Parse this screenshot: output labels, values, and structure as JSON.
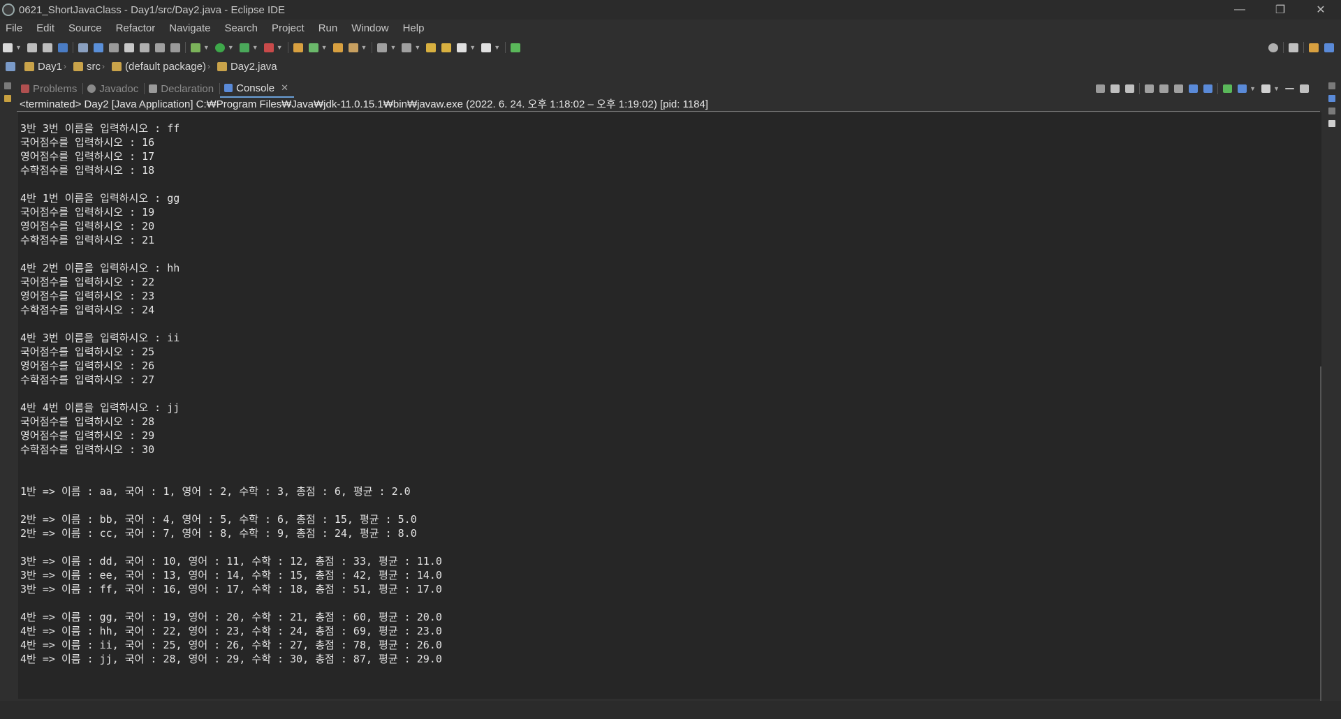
{
  "window": {
    "title": "0621_ShortJavaClass - Day1/src/Day2.java - Eclipse IDE",
    "minimize": "—",
    "restore": "❐",
    "close": "✕"
  },
  "menu": [
    "File",
    "Edit",
    "Source",
    "Refactor",
    "Navigate",
    "Search",
    "Project",
    "Run",
    "Window",
    "Help"
  ],
  "breadcrumb": [
    "Day1",
    "src",
    "(default package)",
    "Day2.java"
  ],
  "tabs": [
    {
      "label": "Problems",
      "icon": "problems-icon",
      "color": "#c05050"
    },
    {
      "label": "Javadoc",
      "icon": "javadoc-icon",
      "color": "#8a8a8a"
    },
    {
      "label": "Declaration",
      "icon": "declaration-icon",
      "color": "#9a9a9a"
    },
    {
      "label": "Console",
      "icon": "console-icon",
      "color": "#5a8ad8"
    }
  ],
  "console": {
    "status": "<terminated> Day2 [Java Application] C:₩Program Files₩Java₩jdk-11.0.15.1₩bin₩javaw.exe  (2022. 6. 24. 오후 1:18:02 – 오후 1:19:02) [pid: 1184]",
    "lines": [
      "3반 3번 이름을 입력하시오 : ff",
      "국어점수를 입력하시오 : 16",
      "영어점수를 입력하시오 : 17",
      "수학점수를 입력하시오 : 18",
      "",
      "4반 1번 이름을 입력하시오 : gg",
      "국어점수를 입력하시오 : 19",
      "영어점수를 입력하시오 : 20",
      "수학점수를 입력하시오 : 21",
      "",
      "4반 2번 이름을 입력하시오 : hh",
      "국어점수를 입력하시오 : 22",
      "영어점수를 입력하시오 : 23",
      "수학점수를 입력하시오 : 24",
      "",
      "4반 3번 이름을 입력하시오 : ii",
      "국어점수를 입력하시오 : 25",
      "영어점수를 입력하시오 : 26",
      "수학점수를 입력하시오 : 27",
      "",
      "4반 4번 이름을 입력하시오 : jj",
      "국어점수를 입력하시오 : 28",
      "영어점수를 입력하시오 : 29",
      "수학점수를 입력하시오 : 30",
      "",
      "",
      "1반 => 이름 : aa, 국어 : 1, 영어 : 2, 수학 : 3, 총점 : 6, 평균 : 2.0",
      "",
      "2반 => 이름 : bb, 국어 : 4, 영어 : 5, 수학 : 6, 총점 : 15, 평균 : 5.0",
      "2반 => 이름 : cc, 국어 : 7, 영어 : 8, 수학 : 9, 총점 : 24, 평균 : 8.0",
      "",
      "3반 => 이름 : dd, 국어 : 10, 영어 : 11, 수학 : 12, 총점 : 33, 평균 : 11.0",
      "3반 => 이름 : ee, 국어 : 13, 영어 : 14, 수학 : 15, 총점 : 42, 평균 : 14.0",
      "3반 => 이름 : ff, 국어 : 16, 영어 : 17, 수학 : 18, 총점 : 51, 평균 : 17.0",
      "",
      "4반 => 이름 : gg, 국어 : 19, 영어 : 20, 수학 : 21, 총점 : 60, 평균 : 20.0",
      "4반 => 이름 : hh, 국어 : 22, 영어 : 23, 수학 : 24, 총점 : 69, 평균 : 23.0",
      "4반 => 이름 : ii, 국어 : 25, 영어 : 26, 수학 : 27, 총점 : 78, 평균 : 26.0",
      "4반 => 이름 : jj, 국어 : 28, 영어 : 29, 수학 : 30, 총점 : 87, 평균 : 29.0"
    ]
  }
}
